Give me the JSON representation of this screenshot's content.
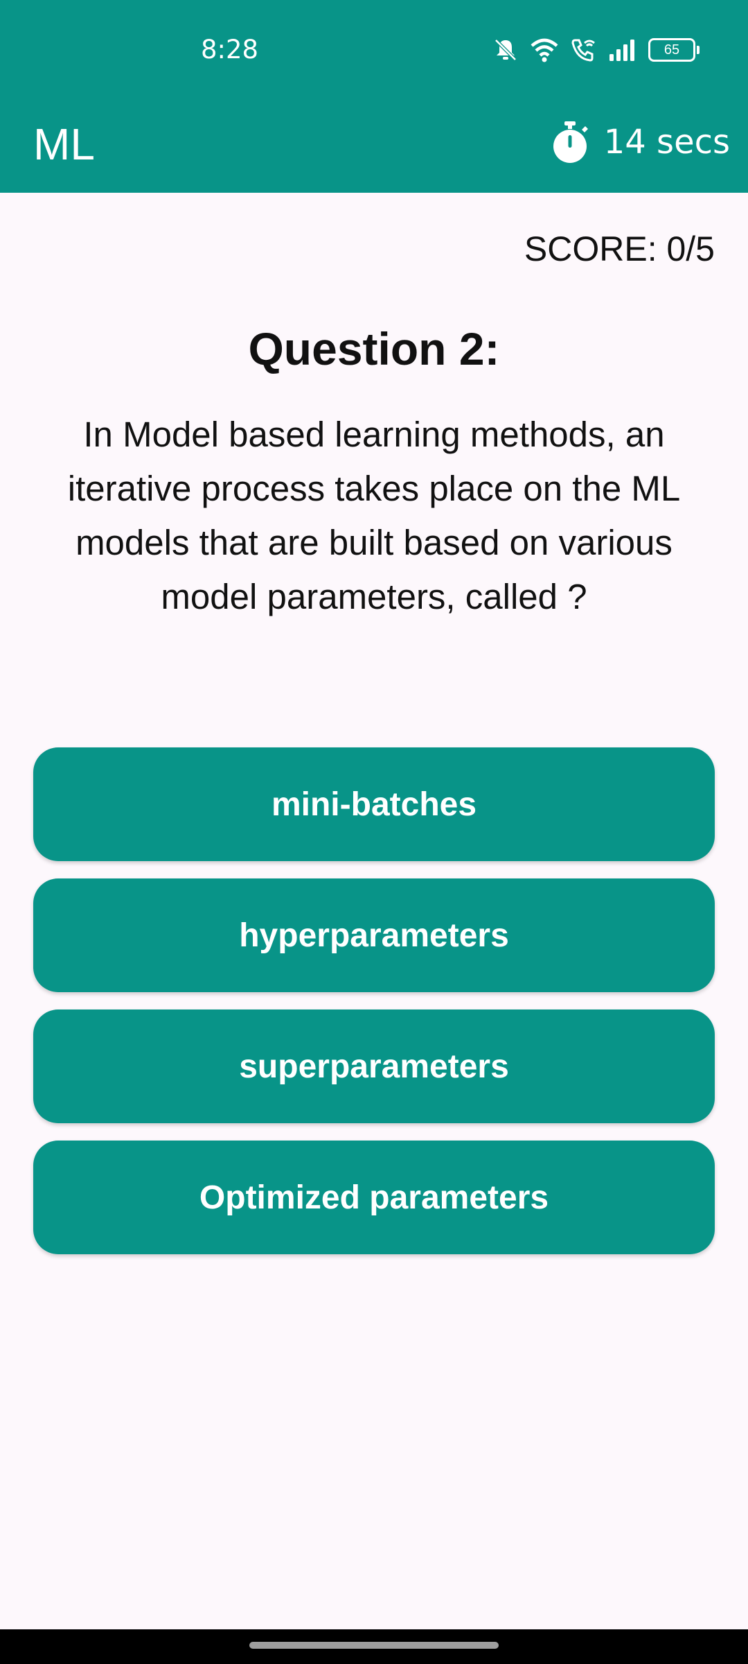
{
  "status_bar": {
    "time": "8:28",
    "battery": "65",
    "icons": [
      "mute-icon",
      "wifi-icon",
      "wifi-call-icon",
      "signal-icon",
      "battery-icon"
    ]
  },
  "app_bar": {
    "title": "ML",
    "timer_icon": "stopwatch-icon",
    "timer_text": "14 secs"
  },
  "score": "SCORE: 0/5",
  "question": {
    "title": "Question 2:",
    "text": "In Model based learning methods, an iterative process takes place on the ML models that are built based on various model parameters, called ?"
  },
  "answers": [
    {
      "label": "mini-batches"
    },
    {
      "label": "hyperparameters"
    },
    {
      "label": "superparameters"
    },
    {
      "label": "Optimized parameters"
    }
  ],
  "colors": {
    "primary": "#089488",
    "background": "#fdf8fc",
    "text": "#111111",
    "on_primary": "#ffffff"
  }
}
